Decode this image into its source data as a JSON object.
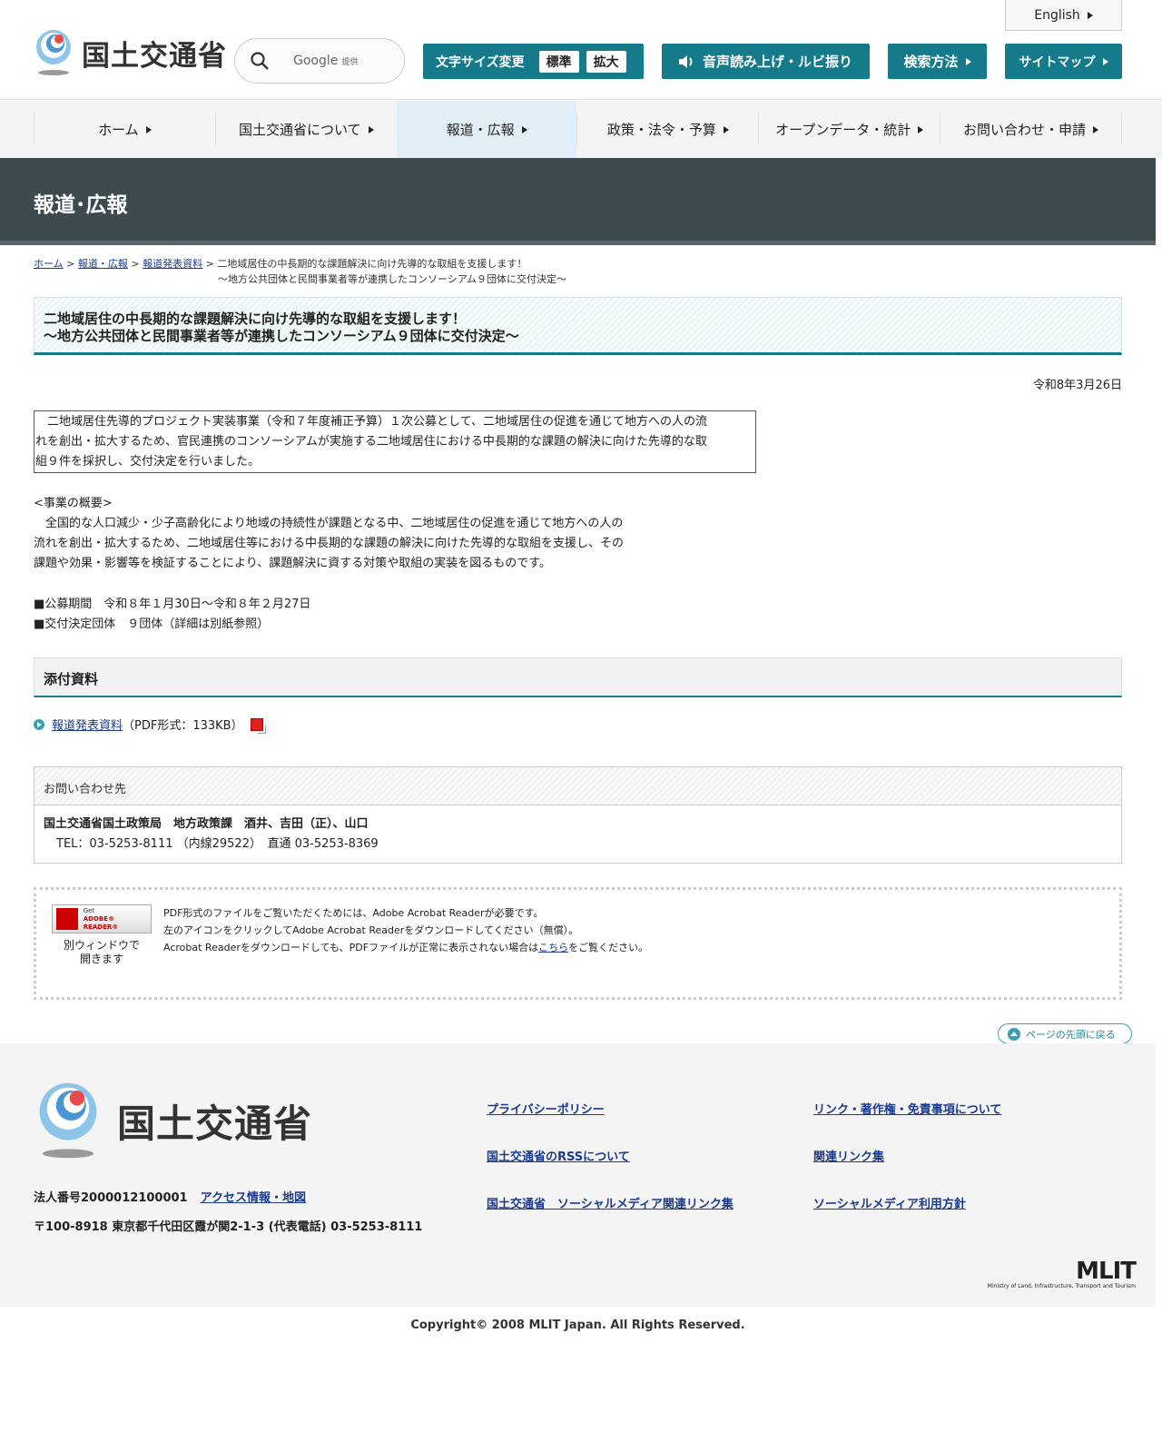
{
  "header": {
    "logo_text": "国土交通省",
    "search_google": "Google",
    "search_provided": "提供",
    "english": "English",
    "font_size_label": "文字サイズ変更",
    "font_standard": "標準",
    "font_large": "拡大",
    "tts": "音声読み上げ・ルビ振り",
    "search_method": "検索方法",
    "sitemap": "サイトマップ"
  },
  "nav": {
    "items": [
      "ホーム",
      "国土交通省について",
      "報道・広報",
      "政策・法令・予算",
      "オープンデータ・統計",
      "お問い合わせ・申請"
    ]
  },
  "band_title": "報道･広報",
  "breadcrumb": {
    "home": "ホーム",
    "press": "報道・広報",
    "releases": "報道発表資料",
    "current_1": "二地域居住の中長期的な課題解決に向け先導的な取組を支援します！",
    "current_2": "～地方公共団体と民間事業者等が連携したコンソーシアム９団体に交付決定～",
    "sep": ">"
  },
  "article": {
    "title_1": "二地域居住の中長期的な課題解決に向け先導的な取組を支援します！",
    "title_2": "～地方公共団体と民間事業者等が連携したコンソーシアム９団体に交付決定～",
    "date": "令和8年3月26日",
    "lead_1": "　二地域居住先導的プロジェクト実装事業（令和７年度補正予算）１次公募として、二地域居住の促進を通じて地方への人の流",
    "lead_2": "れを創出・拡大するため、官民連携のコンソーシアムが実施する二地域居住における中長期的な課題の解決に向けた先導的な取",
    "lead_3": "組９件を採択し、交付決定を行いました。",
    "overview_head": "<事業の概要>",
    "overview_1": "　全国的な人口減少・少子高齢化により地域の持続性が課題となる中、二地域居住の促進を通じて地方への人の",
    "overview_2": "流れを創出・拡大するため、二地域居住等における中長期的な課題の解決に向けた先導的な取組を支援し、その",
    "overview_3": "課題や効果・影響等を検証することにより、課題解決に資する対策や取組の実装を図るものです。",
    "term_1": "■公募期間　令和８年１月30日～令和８年２月27日",
    "term_2": "■交付決定団体　９団体（詳細は別紙参照）"
  },
  "attachments": {
    "heading": "添付資料",
    "link": "報道発表資料",
    "info": "（PDF形式：133KB）"
  },
  "contact": {
    "heading": "お問い合わせ先",
    "org": "国土交通省国土政策局　地方政策課　酒井、吉田（正）、山口",
    "tel": "TEL：03-5253-8111 （内線29522）　直通 03-5253-8369"
  },
  "reader": {
    "btn_get": "Get",
    "btn_name": "ADOBE® READER®",
    "note_1": "別ウィンドウで",
    "note_2": "開きます",
    "line_1": "PDF形式のファイルをご覧いただくためには、Adobe Acrobat Readerが必要です。",
    "line_2": "左のアイコンをクリックしてAdobe Acrobat Readerをダウンロードしてください（無償）。",
    "line_3_pre": "Acrobat Readerをダウンロードしても、PDFファイルが正常に表示されない場合は",
    "line_3_link": "こちら",
    "line_3_post": "をご覧ください。"
  },
  "pagetop": "ページの先頭に戻る",
  "footer": {
    "logo_text": "国土交通省",
    "corp_no": "法人番号2000012100001",
    "access": "アクセス情報・地図",
    "address": "〒100-8918 東京都千代田区霞が関2-1-3 (代表電話) 03-5253-8111",
    "links": [
      "プライバシーポリシー",
      "リンク・著作権・免責事項について",
      "国土交通省のRSSについて",
      "関連リンク集",
      "国土交通省　ソーシャルメディア関連リンク集",
      "ソーシャルメディア利用方針"
    ],
    "mlit": "MLIT",
    "mlit_sub": "Ministry of Land, Infrastructure, Transport and Tourism",
    "copyright": "Copyright© 2008 MLIT Japan. All Rights Reserved."
  },
  "colors": {
    "accent": "#157a8a",
    "band": "#3d4a50",
    "link": "#1a3b8f"
  }
}
